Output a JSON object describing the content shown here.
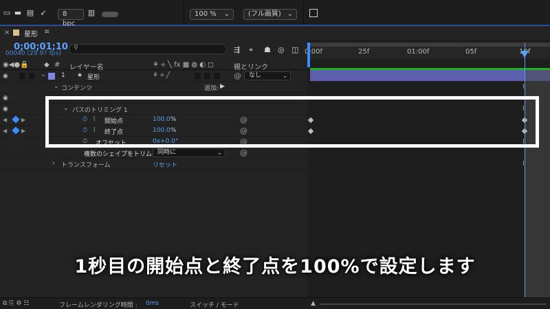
{
  "toolbar": {
    "bpc_label": "8 bpc",
    "zoom_value": "100 %",
    "quality_value": "(フル画質)"
  },
  "tab": {
    "close": "×",
    "comp_name": "星形",
    "menu": "≡"
  },
  "timeline": {
    "current_time": "0;00;01;10",
    "frame_info": "00040 (29.97 fps)",
    "search_placeholder": "",
    "ruler_labels": [
      "0:00f",
      "25f",
      "01:00f",
      "05f",
      "10f"
    ]
  },
  "columns": {
    "layer_name": "レイヤー名",
    "parent_link": "親とリンク"
  },
  "layers": [
    {
      "number": "1",
      "name": "星形",
      "parent": "なし"
    }
  ],
  "properties": {
    "contents": "コンテンツ",
    "add_label": "追加:",
    "trim_paths": "パスのトリミング 1",
    "start_label": "開始点",
    "start_value": "100.0",
    "start_unit": "%",
    "end_label": "終了点",
    "end_value": "100.0",
    "end_unit": "%",
    "offset_label": "オフセット",
    "offset_value": "0x+0.0",
    "offset_unit": "°",
    "trim_multiple_label": "複数のシェイプをトリム",
    "trim_multiple_value": "同時に",
    "transform_label": "トランスフォーム",
    "reset_label": "リセット"
  },
  "caption": "1秒目の開始点と終了点を100%で設定します",
  "bottom": {
    "render_time_label": "フレームレンダリング時間 :",
    "render_time_value": "0ms",
    "switch_mode": "スイッチ / モード"
  },
  "colors": {
    "accent_blue": "#5aa0f5",
    "layer_bar": "#5b5fae",
    "keyframe_blue": "#3a8dff",
    "work_area_green": "#1db31d",
    "highlight": "#ffffff"
  }
}
